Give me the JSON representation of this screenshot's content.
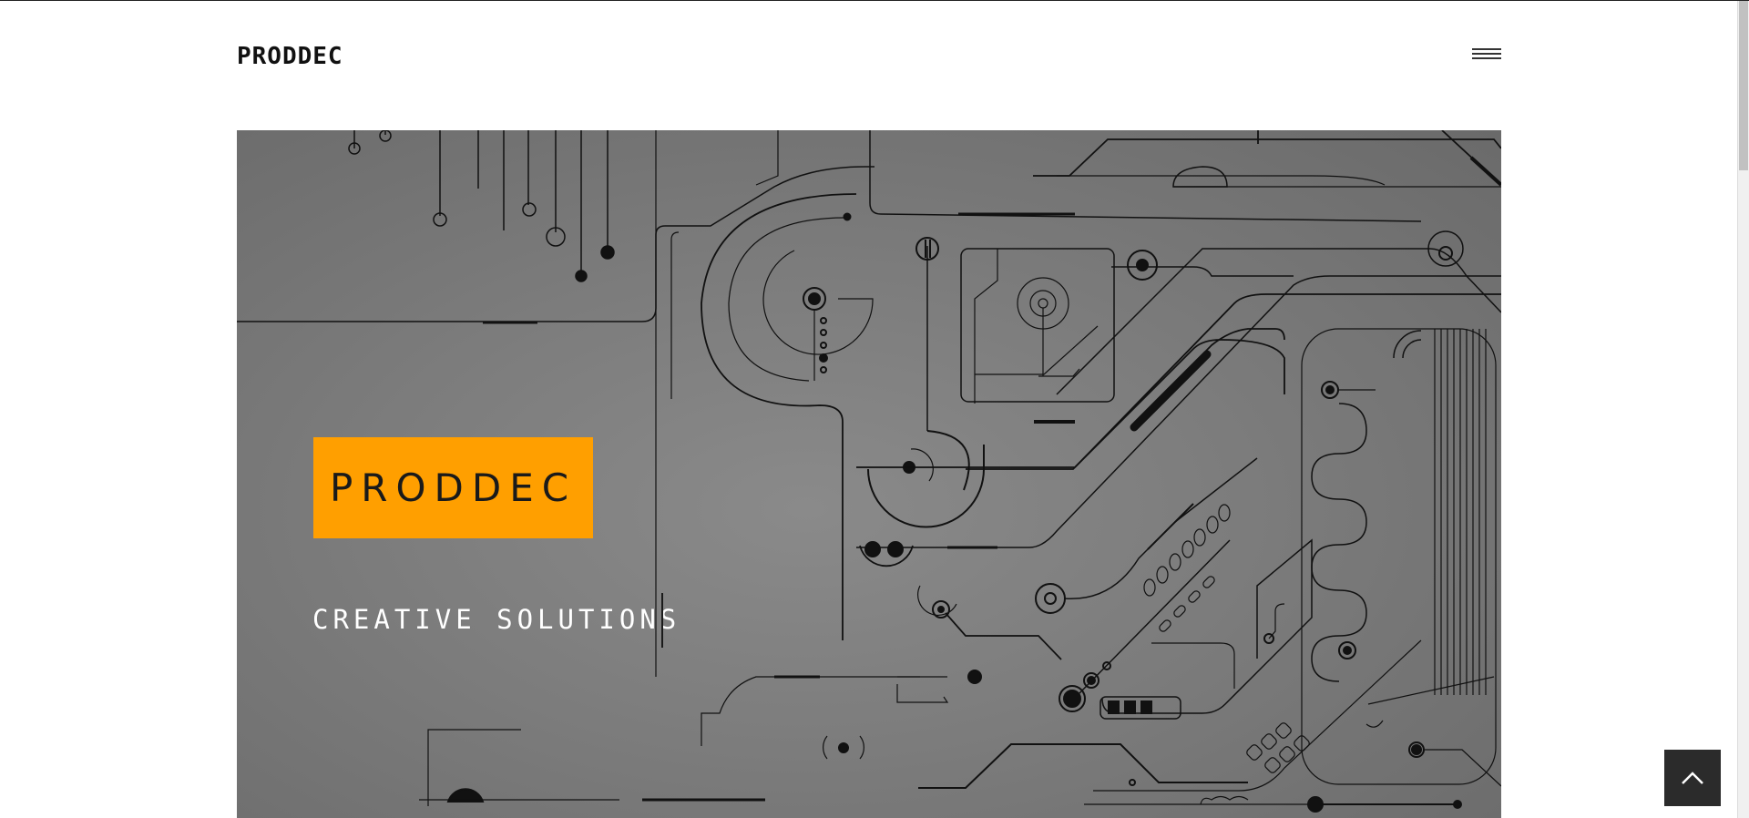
{
  "header": {
    "brand": "PRODDEC",
    "menu_icon": "hamburger-menu-icon"
  },
  "hero": {
    "badge_text": "PRODDEC",
    "tagline": "CREATIVE SOLUTIONS",
    "background_art": "circuit-board-illustration"
  },
  "back_to_top": {
    "icon": "chevron-up-icon"
  },
  "colors": {
    "accent": "#ff9f00",
    "hero_bg": "#7c7c7c",
    "text_dark": "#111111",
    "button_bg": "#2b2b2b"
  }
}
